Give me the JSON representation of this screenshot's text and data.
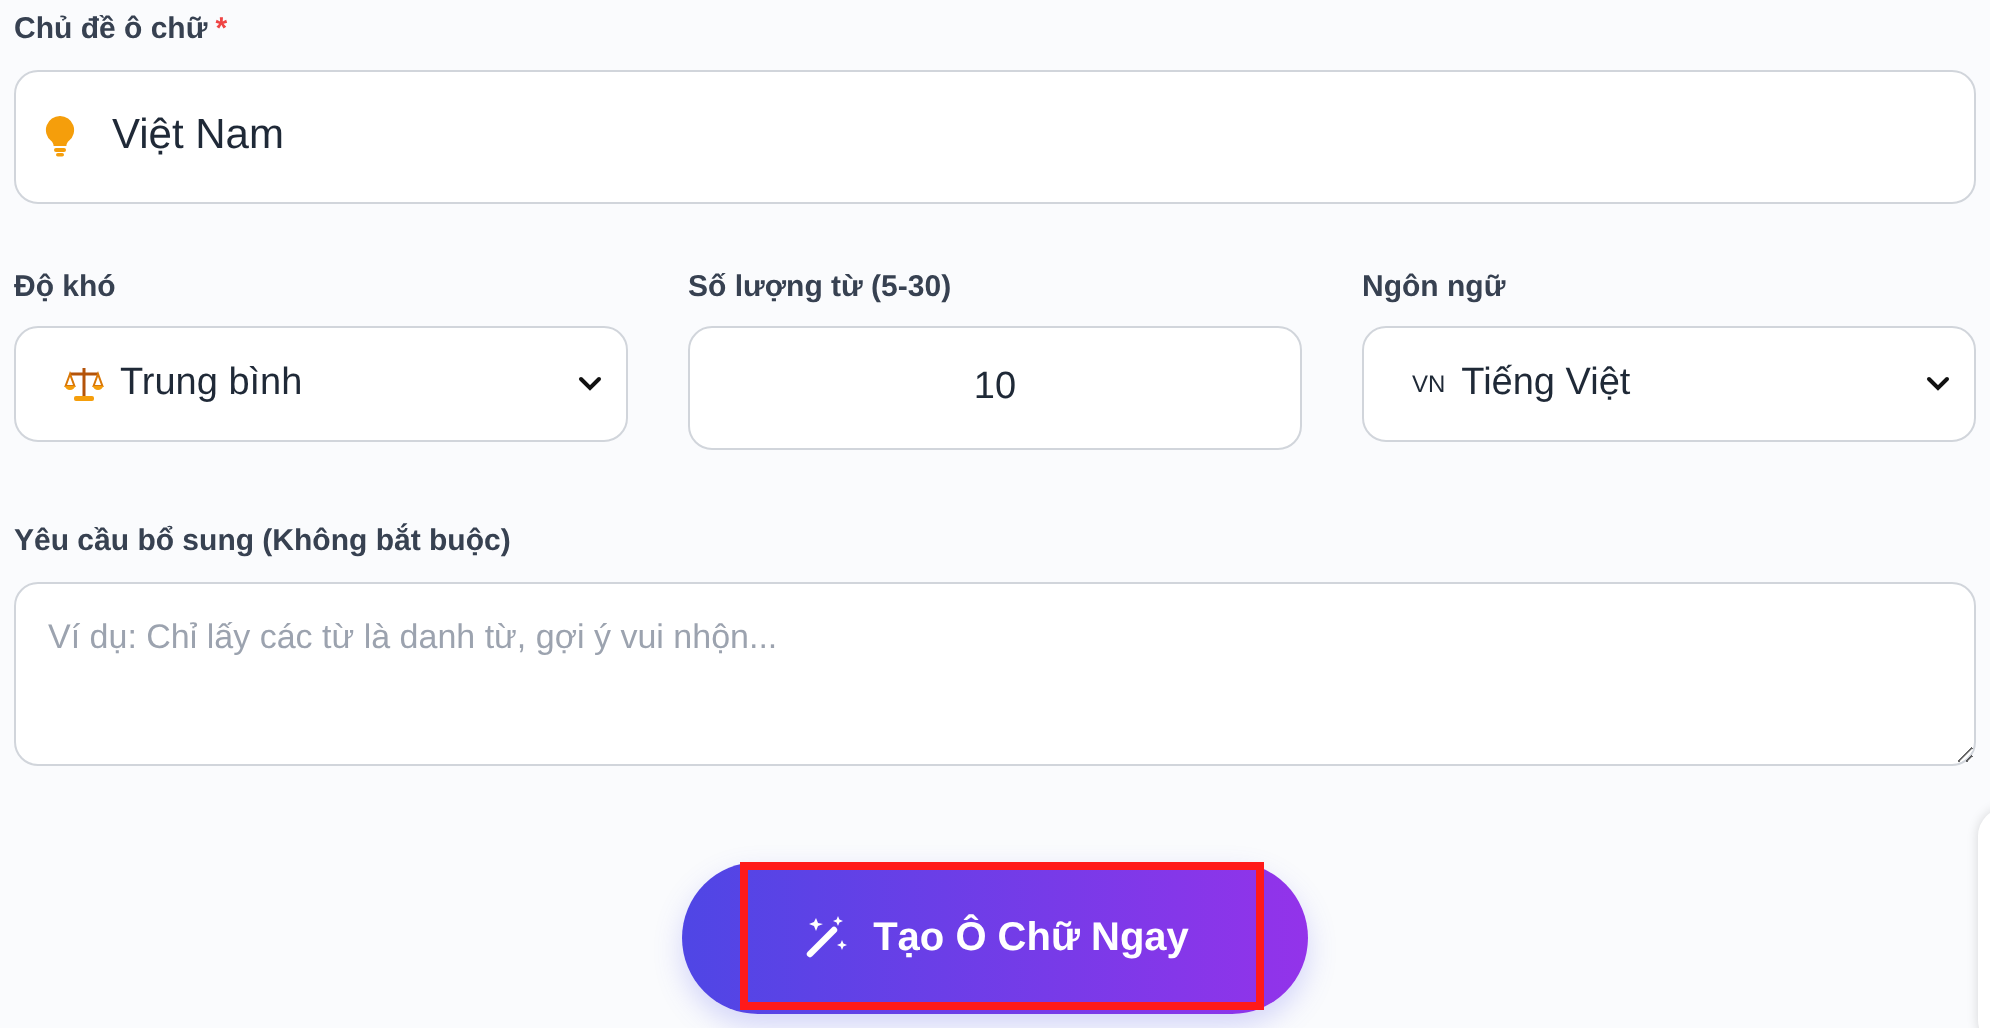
{
  "topic": {
    "label": "Chủ đề ô chữ",
    "required_mark": "*",
    "value": "Việt Nam"
  },
  "settings": [
    {
      "kind": "select",
      "label": "Độ khó",
      "value": "Trung bình"
    },
    {
      "kind": "number",
      "label": "Số lượng từ (5-30)",
      "value": "10"
    },
    {
      "kind": "select",
      "label": "Ngôn ngữ",
      "prefix": "VN",
      "value": "Tiếng Việt"
    }
  ],
  "extra": {
    "label": "Yêu cầu bổ sung (Không bắt buộc)",
    "placeholder": "Ví dụ: Chỉ lấy các từ là danh từ, gợi ý vui nhộn..."
  },
  "submit": {
    "label": "Tạo Ô Chữ Ngay",
    "highlighted": true
  }
}
